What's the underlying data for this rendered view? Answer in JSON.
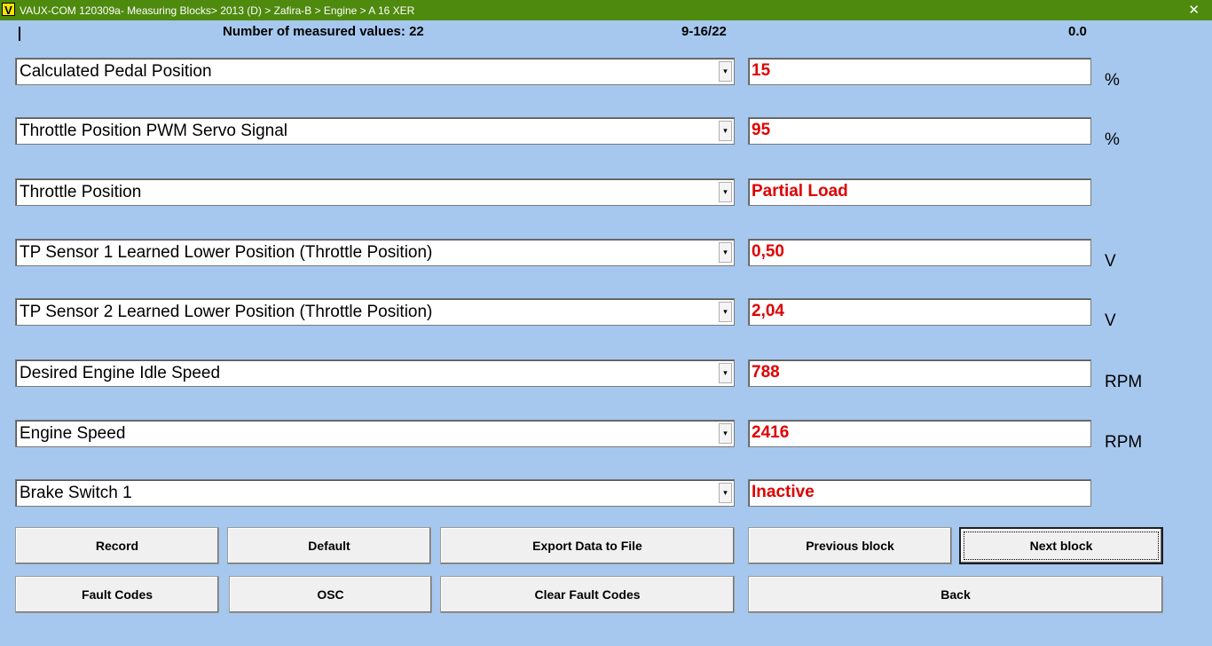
{
  "window": {
    "title": "VAUX-COM 120309a- Measuring Blocks> 2013 (D) > Zafira-B > Engine > A 16 XER",
    "logo": "V",
    "close": "✕"
  },
  "header": {
    "count_label": "Number of measured values: 22",
    "range": "9-16/22",
    "value": "0.0"
  },
  "rows": [
    {
      "param": "Calculated Pedal Position",
      "value": "15",
      "unit": "%"
    },
    {
      "param": "Throttle Position PWM Servo Signal",
      "value": "95",
      "unit": "%"
    },
    {
      "param": "Throttle Position",
      "value": "Partial Load",
      "unit": ""
    },
    {
      "param": "TP Sensor 1 Learned Lower Position (Throttle Position)",
      "value": "0,50",
      "unit": "V"
    },
    {
      "param": "TP Sensor 2 Learned Lower Position (Throttle Position)",
      "value": "2,04",
      "unit": "V"
    },
    {
      "param": "Desired Engine Idle Speed",
      "value": "788",
      "unit": "RPM"
    },
    {
      "param": "Engine Speed",
      "value": "2416",
      "unit": "RPM"
    },
    {
      "param": "Brake Switch 1",
      "value": "Inactive",
      "unit": ""
    }
  ],
  "dropdown_arrow": "▾",
  "buttons": {
    "record": "Record",
    "default": "Default",
    "export": "Export Data to File",
    "previous": "Previous block",
    "next": "Next block",
    "fault_codes": "Fault Codes",
    "osc": "OSC",
    "clear_fault_codes": "Clear Fault Codes",
    "back": "Back"
  },
  "colors": {
    "background": "#a6c8ee",
    "titlebar": "#4e8a0e",
    "value_text": "#e00000"
  }
}
